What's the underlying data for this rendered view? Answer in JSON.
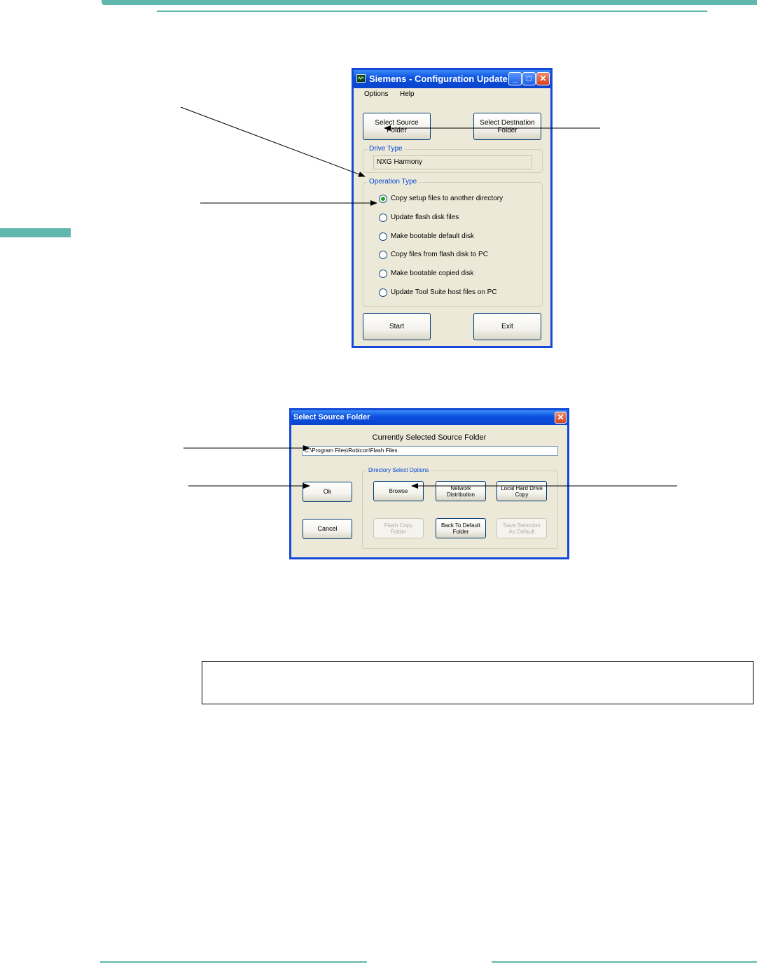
{
  "colors": {
    "accent": "#5fb7ad",
    "xp_title_blue": "#0a4ee0",
    "xp_face": "#ece9d8",
    "group_label_blue": "#0046d5"
  },
  "config_window": {
    "title": "Siemens - Configuration Update",
    "icon": "app-icon",
    "controls": [
      "minimize-icon",
      "maximize-icon",
      "close-icon"
    ],
    "menu": [
      "Options",
      "Help"
    ],
    "select_source_label": "Select Source\nFolder",
    "select_destination_label": "Select Destnation\nFolder",
    "drive_type_label": "Drive Type",
    "drive_type_value": "NXG Harmony",
    "operation_type_label": "Operation Type",
    "operations": [
      {
        "label": "Copy setup files to another directory",
        "checked": true
      },
      {
        "label": "Update flash disk files",
        "checked": false
      },
      {
        "label": "Make bootable default disk",
        "checked": false
      },
      {
        "label": "Copy files from flash disk to PC",
        "checked": false
      },
      {
        "label": "Make bootable copied disk",
        "checked": false
      },
      {
        "label": "Update Tool Suite host files on PC",
        "checked": false
      }
    ],
    "start_label": "Start",
    "exit_label": "Exit"
  },
  "source_dialog": {
    "title": "Select Source Folder",
    "heading": "Currently Selected Source Folder",
    "path_value": "C:\\Program Files\\Robicon\\Flash Files",
    "ok_label": "Ok",
    "cancel_label": "Cancel",
    "options_group_label": "Directory Select Options",
    "browse_label": "Browse",
    "network_label": "Network\nDistribution",
    "local_label": "Local Hard Drive\nCopy",
    "flash_copy_label": "Flash Copy\nFolder",
    "back_default_label": "Back To Default\nFolder",
    "save_default_label": "Save Selection\nAs Default"
  },
  "note_box": {
    "text": ""
  }
}
